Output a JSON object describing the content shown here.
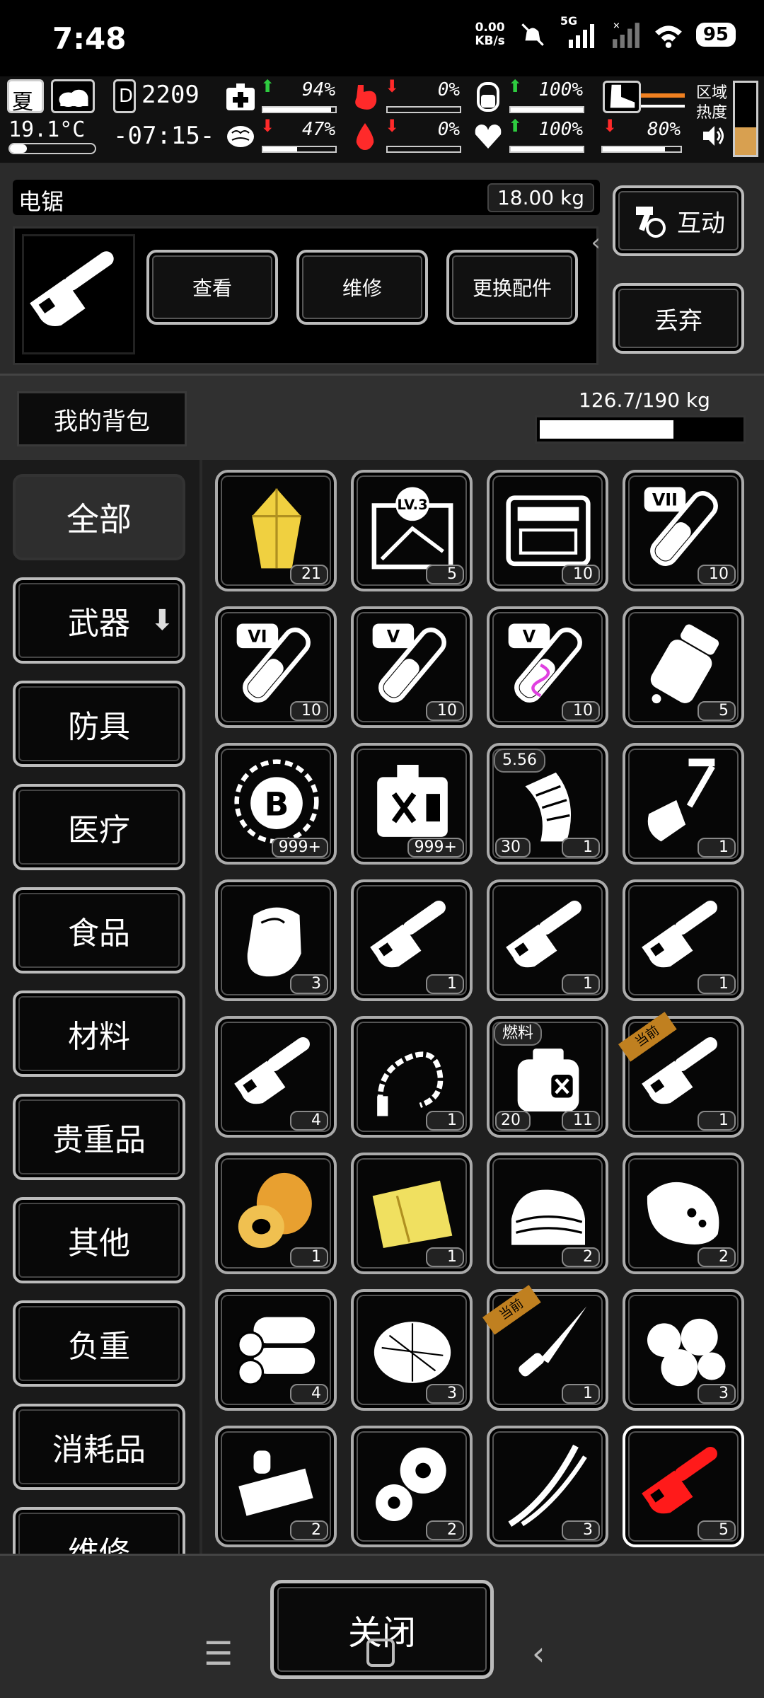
{
  "status": {
    "time": "7:48",
    "speed_top": "0.00",
    "speed_bottom": "KB/s",
    "network": "5G",
    "battery": "95"
  },
  "hud": {
    "season": "夏",
    "temperature": "19.1°C",
    "day": "2209",
    "clock": "-07:15-",
    "stats": [
      {
        "name": "health",
        "value": "94%",
        "dir": "up",
        "fill": 0.94
      },
      {
        "name": "stomach",
        "value": "0%",
        "dir": "down",
        "fill": 0
      },
      {
        "name": "water-bottle",
        "value": "100%",
        "dir": "up",
        "fill": 1.0
      },
      {
        "name": "brain",
        "value": "47%",
        "dir": "down",
        "fill": 0.47
      },
      {
        "name": "blood",
        "value": "0%",
        "dir": "down",
        "fill": 0
      },
      {
        "name": "heart",
        "value": "100%",
        "dir": "up",
        "fill": 1.0
      },
      {
        "name": "boot",
        "value": "80%",
        "dir": "down",
        "fill": 0.8
      }
    ],
    "area_label_1": "区域",
    "area_label_2": "热度"
  },
  "selected_item": {
    "name": "电锯",
    "weight": "18.00 kg",
    "actions": [
      "查看",
      "维修",
      "更换配件"
    ],
    "interact": "互动",
    "discard": "丢弃"
  },
  "backpack": {
    "title": "我的背包",
    "weight": "126.7/190 kg",
    "fill": 0.667
  },
  "categories": [
    "全部",
    "武器",
    "防具",
    "医疗",
    "食品",
    "材料",
    "贵重品",
    "其他",
    "负重",
    "消耗品",
    "维修"
  ],
  "items": [
    {
      "icon": "gold-crystal",
      "count": "21"
    },
    {
      "icon": "map-lv3",
      "count": "5",
      "label": "LV.3"
    },
    {
      "icon": "toolkit-case",
      "count": "10"
    },
    {
      "icon": "test-tube-vii",
      "count": "10",
      "label": "VII"
    },
    {
      "icon": "test-tube-vi",
      "count": "10",
      "label": "VI"
    },
    {
      "icon": "test-tube-v",
      "count": "10",
      "label": "V"
    },
    {
      "icon": "dna-syringe-v",
      "count": "10",
      "label": "V"
    },
    {
      "icon": "pill-bottle",
      "count": "5"
    },
    {
      "icon": "coin-b",
      "count": "999+"
    },
    {
      "icon": "fuel-can",
      "count": "999+"
    },
    {
      "icon": "ammo-magazine",
      "count": "1",
      "count2": "30",
      "tag": "5.56"
    },
    {
      "icon": "shovel",
      "count": "1"
    },
    {
      "icon": "glove",
      "count": "3"
    },
    {
      "icon": "chainsaw",
      "count": "1"
    },
    {
      "icon": "chainsaw",
      "count": "1"
    },
    {
      "icon": "chainsaw",
      "count": "1"
    },
    {
      "icon": "chainsaw",
      "count": "4"
    },
    {
      "icon": "whip",
      "count": "1"
    },
    {
      "icon": "fuel-tank",
      "count": "11",
      "count2": "20",
      "tag": "燃料"
    },
    {
      "icon": "chainsaw",
      "count": "1",
      "ribbon": "当前"
    },
    {
      "icon": "tape-roll",
      "count": "1"
    },
    {
      "icon": "gold-cloth",
      "count": "1"
    },
    {
      "icon": "cloth-pile",
      "count": "2"
    },
    {
      "icon": "meat",
      "count": "2"
    },
    {
      "icon": "logs",
      "count": "4"
    },
    {
      "icon": "fiber-ball",
      "count": "3"
    },
    {
      "icon": "knife",
      "count": "1",
      "ribbon": "当前"
    },
    {
      "icon": "stones",
      "count": "3"
    },
    {
      "icon": "tool-parts",
      "count": "2"
    },
    {
      "icon": "gears",
      "count": "2"
    },
    {
      "icon": "wires",
      "count": "3"
    },
    {
      "icon": "chainsaw-red",
      "count": "5",
      "selected": true
    }
  ],
  "close": "关闭",
  "colors": {
    "accent_red": "#ff1a1a",
    "gold": "#f0d040",
    "up": "#2ecc40"
  }
}
